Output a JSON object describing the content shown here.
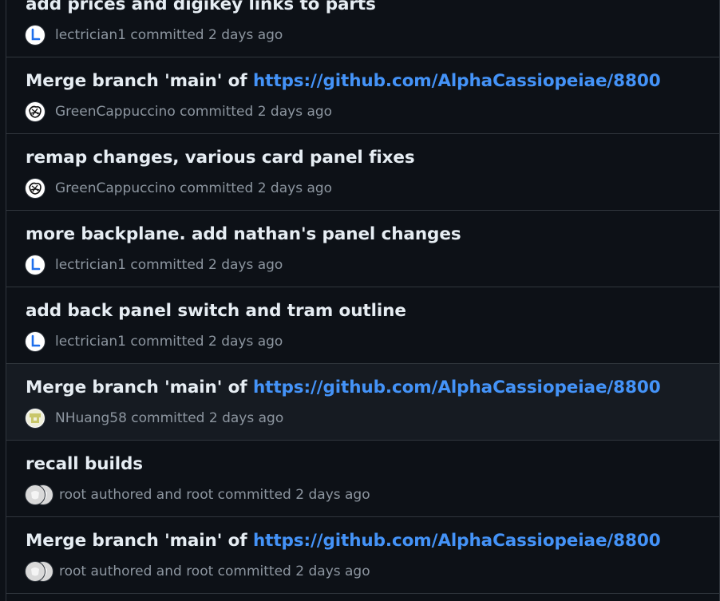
{
  "commits": [
    {
      "title": "add prices and digikey links to parts",
      "link": "",
      "author": "lectrician1",
      "action": "committed",
      "time": "2 days ago",
      "avatar": "lectrician1-avatar"
    },
    {
      "title": "Merge branch 'main' of ",
      "link": "https://github.com/AlphaCassiopeiae/8800",
      "author": "GreenCappuccino",
      "action": "committed",
      "time": "2 days ago",
      "avatar": "greencappuccino-avatar"
    },
    {
      "title": "remap changes, various card panel fixes",
      "link": "",
      "author": "GreenCappuccino",
      "action": "committed",
      "time": "2 days ago",
      "avatar": "greencappuccino-avatar"
    },
    {
      "title": "more backplane. add nathan's panel changes",
      "link": "",
      "author": "lectrician1",
      "action": "committed",
      "time": "2 days ago",
      "avatar": "lectrician1-avatar"
    },
    {
      "title": "add back panel switch and tram outline",
      "link": "",
      "author": "lectrician1",
      "action": "committed",
      "time": "2 days ago",
      "avatar": "lectrician1-avatar"
    },
    {
      "title": "Merge branch 'main' of ",
      "link": "https://github.com/AlphaCassiopeiae/8800",
      "author": "NHuang58",
      "action": "committed",
      "time": "2 days ago",
      "avatar": "nhuang58-avatar"
    },
    {
      "title": "recall builds",
      "link": "",
      "author": "root",
      "action": "authored and root committed",
      "time": "2 days ago",
      "avatar": "root-avatar"
    },
    {
      "title": "Merge branch 'main' of ",
      "link": "https://github.com/AlphaCassiopeiae/8800",
      "author": "root",
      "action": "authored and root committed",
      "time": "2 days ago",
      "avatar": "root-avatar"
    }
  ]
}
